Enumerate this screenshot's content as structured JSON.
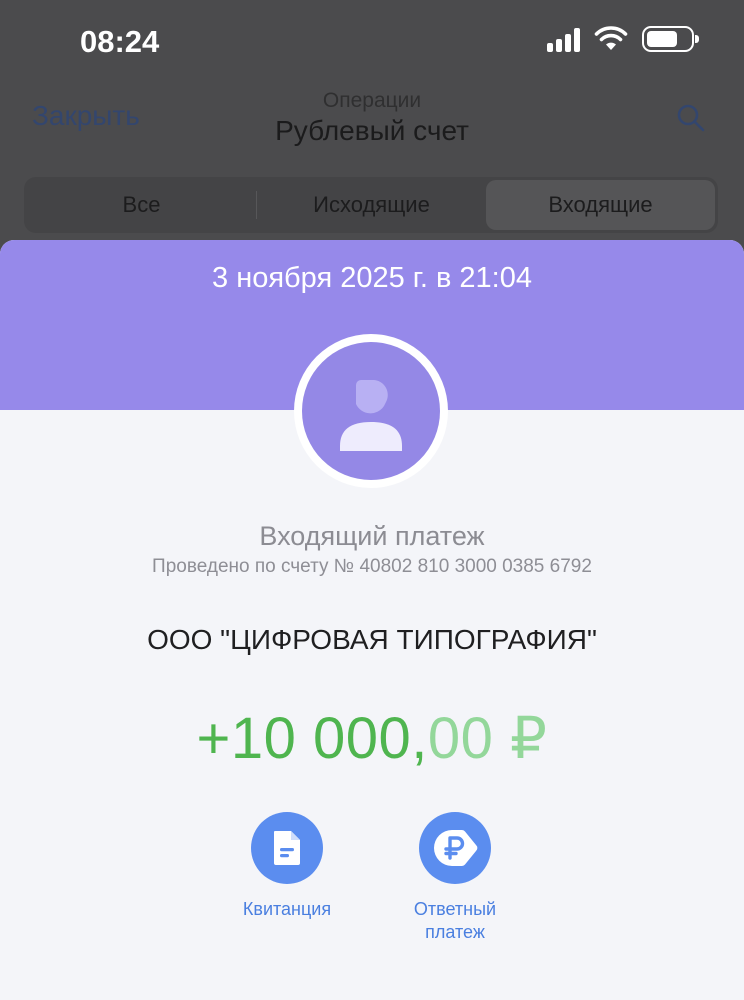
{
  "status_bar": {
    "time": "08:24"
  },
  "nav": {
    "close_label": "Закрыть",
    "subtitle": "Операции",
    "title": "Рублевый счет"
  },
  "filter_tabs": [
    {
      "label": "Все",
      "active": false
    },
    {
      "label": "Исходящие",
      "active": false
    },
    {
      "label": "Входящие",
      "active": true
    }
  ],
  "sheet": {
    "date": "3 ноября 2025 г. в 21:04",
    "operation_type": "Входящий платеж",
    "account_line": "Проведено по счету № 40802 810 3000 0385 6792",
    "counterparty": "ООО \"ЦИФРОВАЯ ТИПОГРАФИЯ\"",
    "amount_main": "+10 000,",
    "amount_fraction": "00 ₽"
  },
  "actions": [
    {
      "label": "Квитанция",
      "icon": "document-icon"
    },
    {
      "label": "Ответный платеж",
      "icon": "ruble-reply-icon"
    }
  ],
  "colors": {
    "header_purple": "#9689ea",
    "amount_green": "#4fb54f",
    "action_blue": "#5b8def"
  }
}
